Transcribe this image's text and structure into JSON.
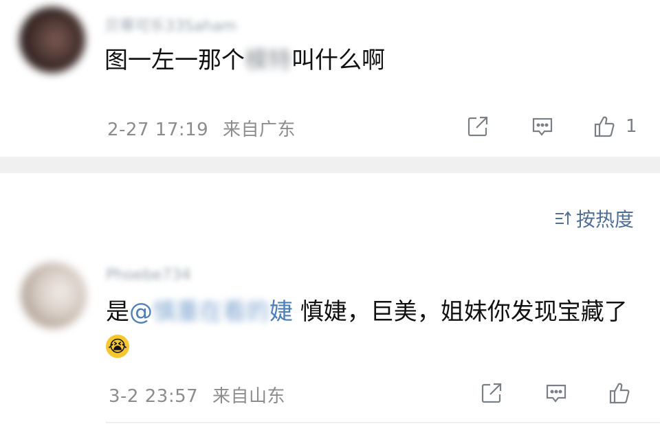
{
  "comment1": {
    "username": "贝蒂可乐33Saham",
    "text_before": "图一左一那个",
    "text_blurred": "模特",
    "text_after": "叫什么啊",
    "time": "2-27 17:19",
    "location": "来自广东",
    "like_count": "1"
  },
  "sort": {
    "label": "按热度",
    "icon": "sort-icon"
  },
  "comment2": {
    "username": "Phoebe734",
    "text_prefix": "是",
    "mention_at": "@",
    "mention_blurred": "慎重在看的",
    "mention_visible": "婕",
    "text_main": " 慎婕，巨美，姐妹你发现宝藏了",
    "emoji": "crying-face-emoji",
    "time": "3-2 23:57",
    "location": "来自山东"
  },
  "icons": {
    "share": "share-icon",
    "comment": "comment-icon",
    "like": "thumbs-up-icon"
  },
  "colors": {
    "link": "#4f7fb9",
    "meta": "#8c8c8c",
    "divider": "#f0f0f0"
  }
}
